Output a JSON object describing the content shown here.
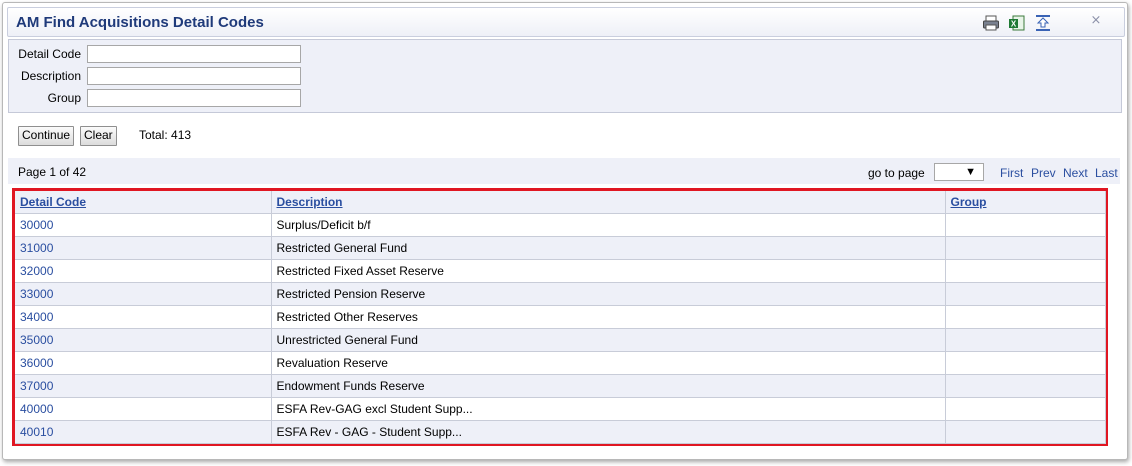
{
  "window": {
    "title": "AM Find Acquisitions Detail Codes",
    "close_label": "⨯"
  },
  "toolbar": {
    "icons": [
      "print-icon",
      "excel-export-icon",
      "collapse-icon"
    ]
  },
  "search": {
    "fields": [
      {
        "label": "Detail Code",
        "value": ""
      },
      {
        "label": "Description",
        "value": ""
      },
      {
        "label": "Group",
        "value": ""
      }
    ],
    "continue_label": "Continue",
    "clear_label": "Clear",
    "total_text": "Total: 413"
  },
  "pager": {
    "page_info": "Page 1 of 42",
    "goto_label": "go to page",
    "goto_value": "",
    "first": "First",
    "prev": "Prev",
    "next": "Next",
    "last": "Last"
  },
  "grid": {
    "columns": [
      "Detail Code",
      "Description",
      "Group"
    ],
    "rows": [
      {
        "code": "30000",
        "description": "Surplus/Deficit b/f",
        "group": ""
      },
      {
        "code": "31000",
        "description": "Restricted General Fund",
        "group": ""
      },
      {
        "code": "32000",
        "description": "Restricted Fixed Asset Reserve",
        "group": ""
      },
      {
        "code": "33000",
        "description": "Restricted Pension Reserve",
        "group": ""
      },
      {
        "code": "34000",
        "description": "Restricted Other Reserves",
        "group": ""
      },
      {
        "code": "35000",
        "description": "Unrestricted General Fund",
        "group": ""
      },
      {
        "code": "36000",
        "description": "Revaluation Reserve",
        "group": ""
      },
      {
        "code": "37000",
        "description": "Endowment Funds Reserve",
        "group": ""
      },
      {
        "code": "40000",
        "description": "ESFA Rev-GAG excl Student Supp...",
        "group": ""
      },
      {
        "code": "40010",
        "description": "ESFA Rev - GAG - Student Supp...",
        "group": ""
      }
    ]
  },
  "colors": {
    "title": "#1f3a7a",
    "link": "#2a4ea0",
    "highlight_border": "#e01622",
    "panel_bg": "#eef0f8"
  }
}
